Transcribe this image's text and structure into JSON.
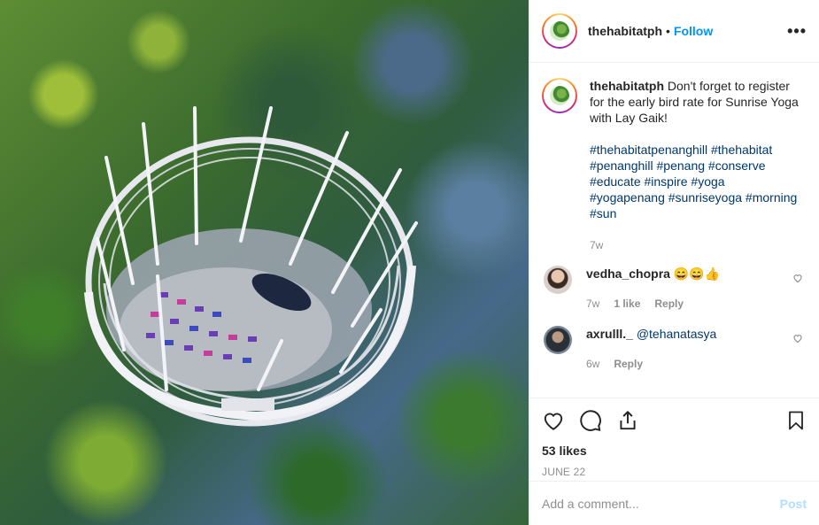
{
  "post": {
    "username": "thehabitatph",
    "follow_label": "Follow",
    "more_label": "•••",
    "caption_text": "Don't forget to register for the early bird rate for Sunrise Yoga with Lay Gaik!",
    "hashtags": "#thehabitatpenanghill #thehabitat #penanghill #penang #conserve #educate #inspire #yoga #yogapenang #sunriseyoga #morning #sun",
    "caption_time": "7w"
  },
  "comments": [
    {
      "username": "vedha_chopra",
      "text": "😄😄👍",
      "time": "7w",
      "likes": "1 like",
      "reply": "Reply"
    },
    {
      "username": "axrulll._",
      "text": "@tehanatasya",
      "time": "6w",
      "reply": "Reply"
    }
  ],
  "footer": {
    "likes": "53 likes",
    "date": "JUNE 22",
    "add_comment_placeholder": "Add a comment...",
    "post_label": "Post"
  },
  "icons": {
    "like": "heart-icon",
    "comment": "comment-icon",
    "share": "share-icon",
    "save": "bookmark-icon"
  },
  "colors": {
    "link": "#0095f6",
    "hashtag": "#00376b",
    "muted": "#8e8e8e",
    "post_disabled": "#b2dffc"
  }
}
